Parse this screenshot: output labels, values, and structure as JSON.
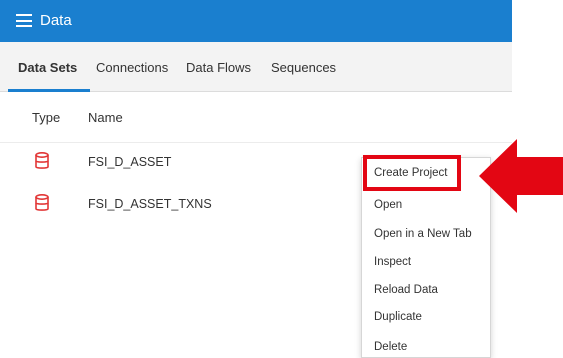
{
  "header": {
    "title": "Data"
  },
  "tabs": [
    {
      "label": "Data Sets",
      "active": true
    },
    {
      "label": "Connections",
      "active": false
    },
    {
      "label": "Data Flows",
      "active": false
    },
    {
      "label": "Sequences",
      "active": false
    }
  ],
  "table": {
    "columns": [
      "Type",
      "Name"
    ],
    "rows": [
      {
        "icon": "database-icon",
        "name": "FSI_D_ASSET"
      },
      {
        "icon": "database-icon",
        "name": "FSI_D_ASSET_TXNS"
      }
    ]
  },
  "context_menu": {
    "items": [
      "Create Project",
      "Open",
      "Open in a New Tab",
      "Inspect",
      "Reload Data",
      "Duplicate",
      "Delete"
    ],
    "highlighted_item": "Create Project"
  },
  "colors": {
    "header_bg": "#1a7fcf",
    "tab_bar_bg": "#f3f3f3",
    "active_tab_underline": "#1a7fcf",
    "icon_red": "#e23636",
    "callout_red": "#e30613"
  }
}
